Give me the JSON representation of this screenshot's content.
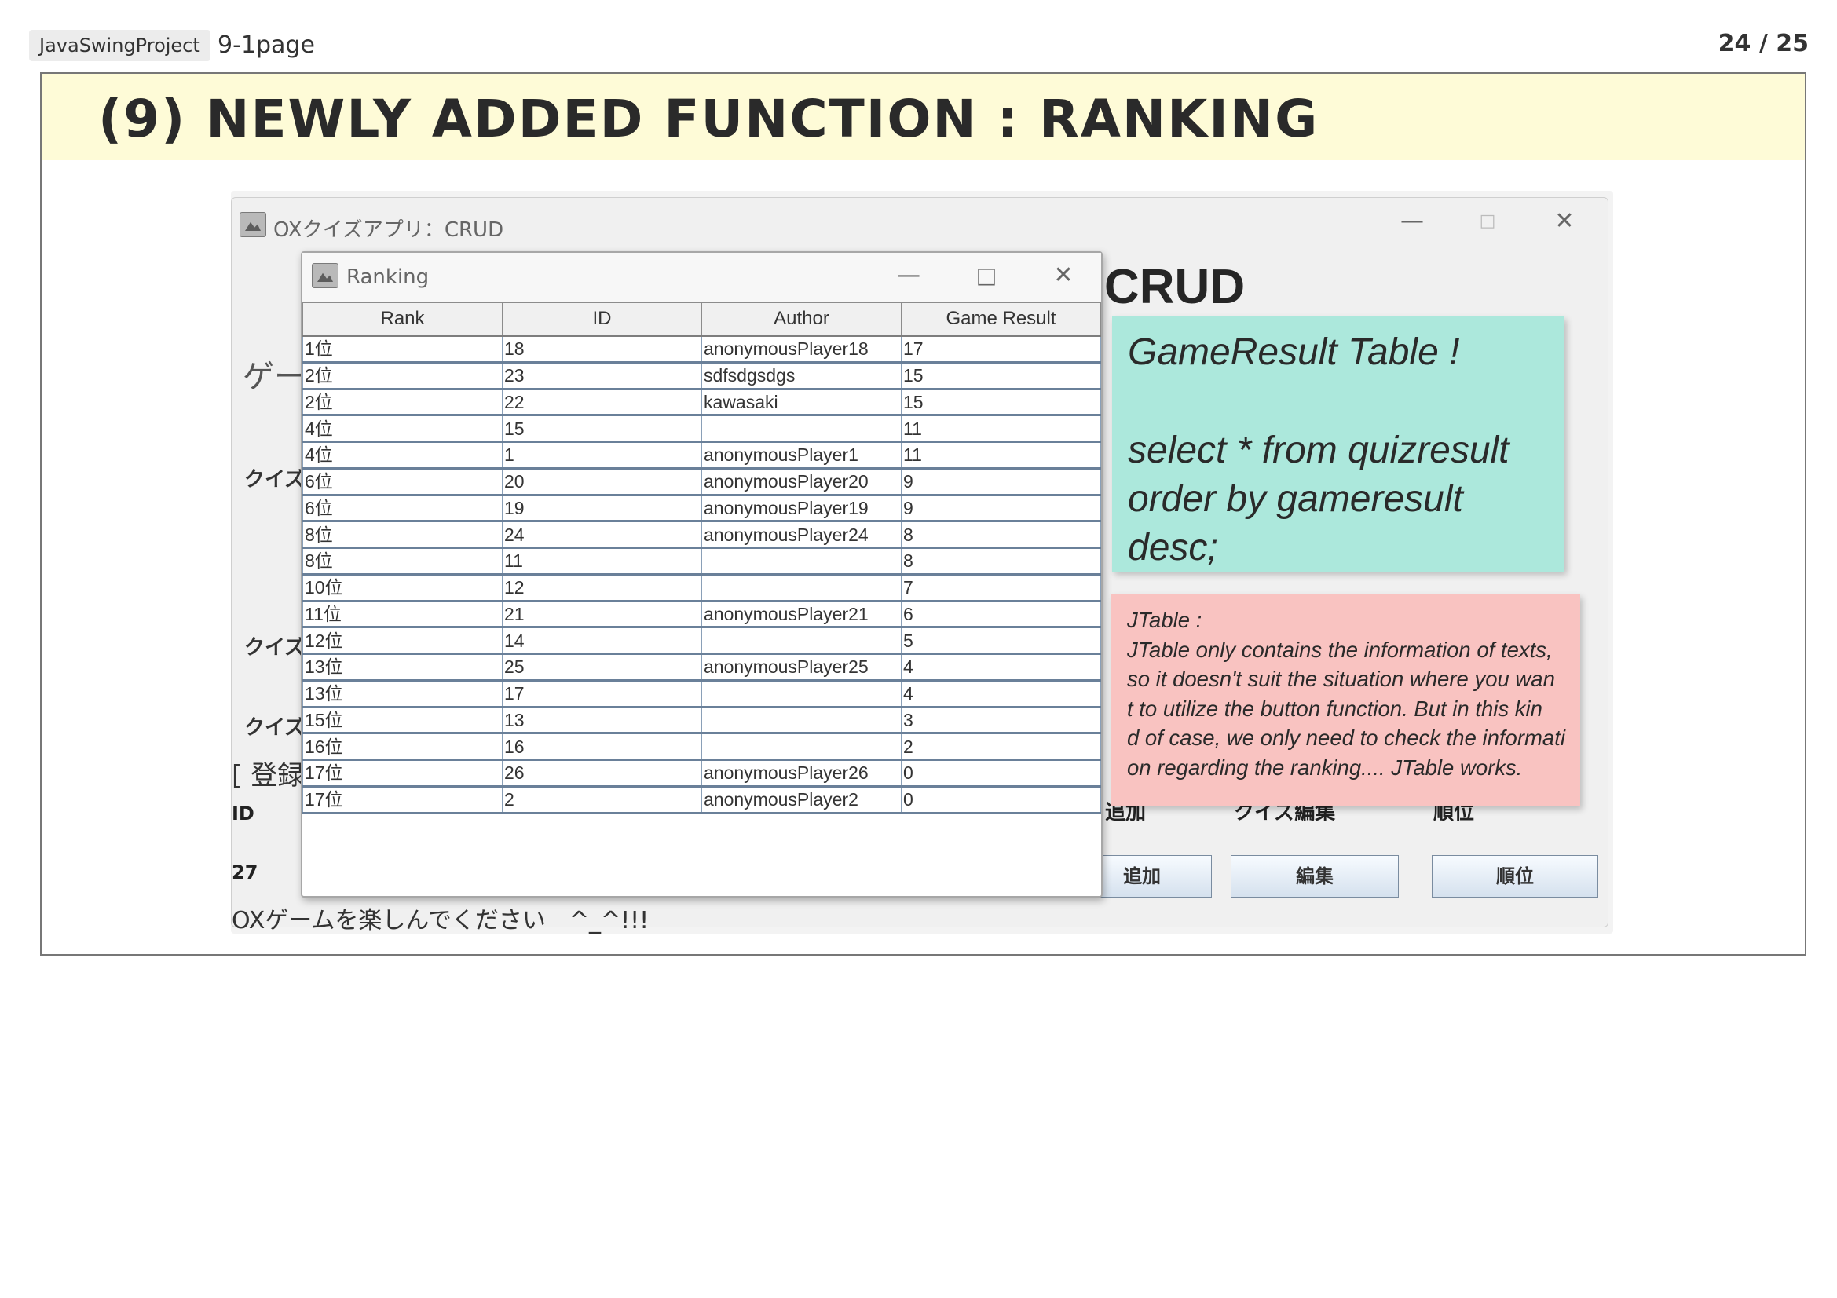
{
  "header": {
    "project_tag": "JavaSwingProject",
    "page_name": "9-1page",
    "page_number": "24 / 25"
  },
  "slide": {
    "title": "(9) NEWLY ADDED FUNCTION : RANKING"
  },
  "main_window": {
    "title": "OXクイズアプリ：CRUD",
    "heading": "CRUD",
    "game_label": "ゲー",
    "quiz_labels": [
      "クイズ",
      "クイズ",
      "クイズ"
    ],
    "register_label": "[ 登録",
    "id_label": "ID",
    "id_value": "27",
    "footer_message": "OXゲームを楽しんでください　^_^!!!",
    "column_labels": [
      "追加",
      "クイズ編集",
      "順位"
    ],
    "buttons": [
      "追加",
      "編集",
      "順位"
    ],
    "window_controls": [
      "minimize-icon",
      "maximize-icon",
      "close-icon"
    ]
  },
  "ranking_window": {
    "title": "Ranking",
    "columns": [
      "Rank",
      "ID",
      "Author",
      "Game Result"
    ],
    "rows": [
      [
        "1位",
        "18",
        "anonymousPlayer18",
        "17"
      ],
      [
        "2位",
        "23",
        "sdfsdgsdgs",
        "15"
      ],
      [
        "2位",
        "22",
        "kawasaki",
        "15"
      ],
      [
        "4位",
        "15",
        "",
        "11"
      ],
      [
        "4位",
        "1",
        "anonymousPlayer1",
        "11"
      ],
      [
        "6位",
        "20",
        "anonymousPlayer20",
        "9"
      ],
      [
        "6位",
        "19",
        "anonymousPlayer19",
        "9"
      ],
      [
        "8位",
        "24",
        "anonymousPlayer24",
        "8"
      ],
      [
        "8位",
        "11",
        "",
        "8"
      ],
      [
        "10位",
        "12",
        "",
        "7"
      ],
      [
        "11位",
        "21",
        "anonymousPlayer21",
        "6"
      ],
      [
        "12位",
        "14",
        "",
        "5"
      ],
      [
        "13位",
        "25",
        "anonymousPlayer25",
        "4"
      ],
      [
        "13位",
        "17",
        "",
        "4"
      ],
      [
        "15位",
        "13",
        "",
        "3"
      ],
      [
        "16位",
        "16",
        "",
        "2"
      ],
      [
        "17位",
        "26",
        "anonymousPlayer26",
        "0"
      ],
      [
        "17位",
        "2",
        "anonymousPlayer2",
        "0"
      ]
    ]
  },
  "notes": {
    "green": {
      "line1": "GameResult Table !",
      "line2": "select * from quizresult",
      "line3": "order by gameresult desc;",
      "color": "#ace8dc"
    },
    "pink": {
      "lines": [
        "JTable :",
        "JTable only contains the information of  texts,",
        "so it doesn't suit the situation where you wan",
        "t to utilize the button function. But in this kin",
        "d of case, we only need to check the informati",
        "on regarding the ranking.... JTable works."
      ],
      "color": "#f9c3c1"
    }
  }
}
